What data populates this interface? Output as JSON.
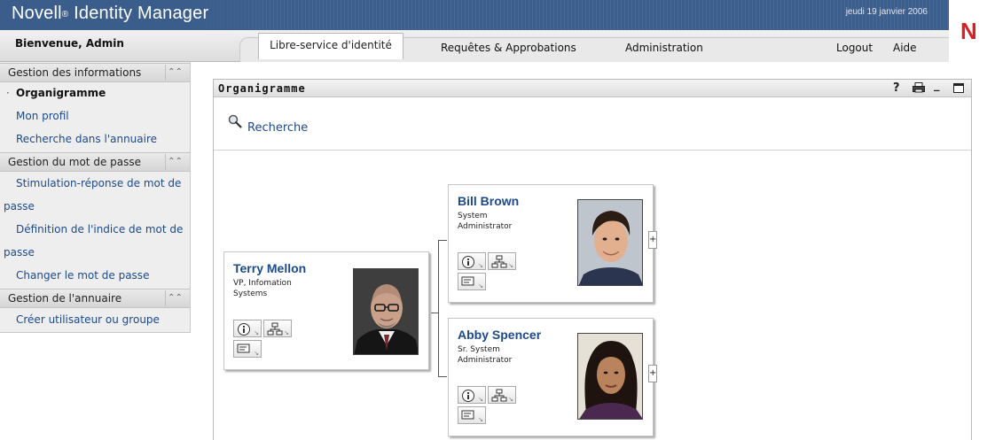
{
  "header": {
    "brand": "Novell",
    "brand_mark": "®",
    "product": "Identity Manager",
    "date": "jeudi 19 janvier 2006",
    "logo_letter": "N",
    "banner_color": "#3d5f8e",
    "logo_color": "#d62127"
  },
  "nav": {
    "welcome": "Bienvenue, Admin",
    "tabs": [
      {
        "label": "Libre-service d'identité",
        "active": true
      },
      {
        "label": "Requêtes & Approbations",
        "active": false
      },
      {
        "label": "Administration",
        "active": false
      }
    ],
    "logout": "Logout",
    "help": "Aide"
  },
  "sidebar": {
    "groups": [
      {
        "title": "Gestion des informations",
        "collapse_icon": "double-chevron-up-icon",
        "items": [
          {
            "label": "Organigramme",
            "active": true
          },
          {
            "label": "Mon profil"
          },
          {
            "label": "Recherche dans l'annuaire"
          }
        ]
      },
      {
        "title": "Gestion du mot de passe",
        "collapse_icon": "double-chevron-up-icon",
        "items": [
          {
            "label": "Stimulation-réponse de mot de",
            "continuation": "passe"
          },
          {
            "label": "Définition de l'indice de mot de",
            "continuation": "passe"
          },
          {
            "label": "Changer le mot de passe"
          }
        ]
      },
      {
        "title": "Gestion de l'annuaire",
        "collapse_icon": "double-chevron-up-icon",
        "items": [
          {
            "label": "Créer utilisateur ou groupe"
          }
        ]
      }
    ]
  },
  "portlet": {
    "title": "Organigramme",
    "tools": {
      "help": "?",
      "print_icon": "print-icon",
      "minimize": "_",
      "maximize_icon": "maximize-icon"
    },
    "search_label": "Recherche",
    "search_icon": "magnifier-icon"
  },
  "chart": {
    "people": [
      {
        "name": "Terry Mellon",
        "lines": [
          "VP, Infomation",
          "Systems"
        ],
        "portrait": "bald-man-glasses-portrait"
      },
      {
        "name": "Bill Brown",
        "lines": [
          "System",
          "Administrator"
        ],
        "portrait": "dark-haired-man-portrait"
      },
      {
        "name": "Abby Spencer",
        "lines": [
          "Sr. System",
          "Administrator"
        ],
        "portrait": "dark-haired-woman-portrait"
      }
    ],
    "action_icons": [
      "info-icon",
      "org-chart-icon",
      "email-icon"
    ],
    "expand_label": "+",
    "link_color": "#1c4a8a"
  }
}
